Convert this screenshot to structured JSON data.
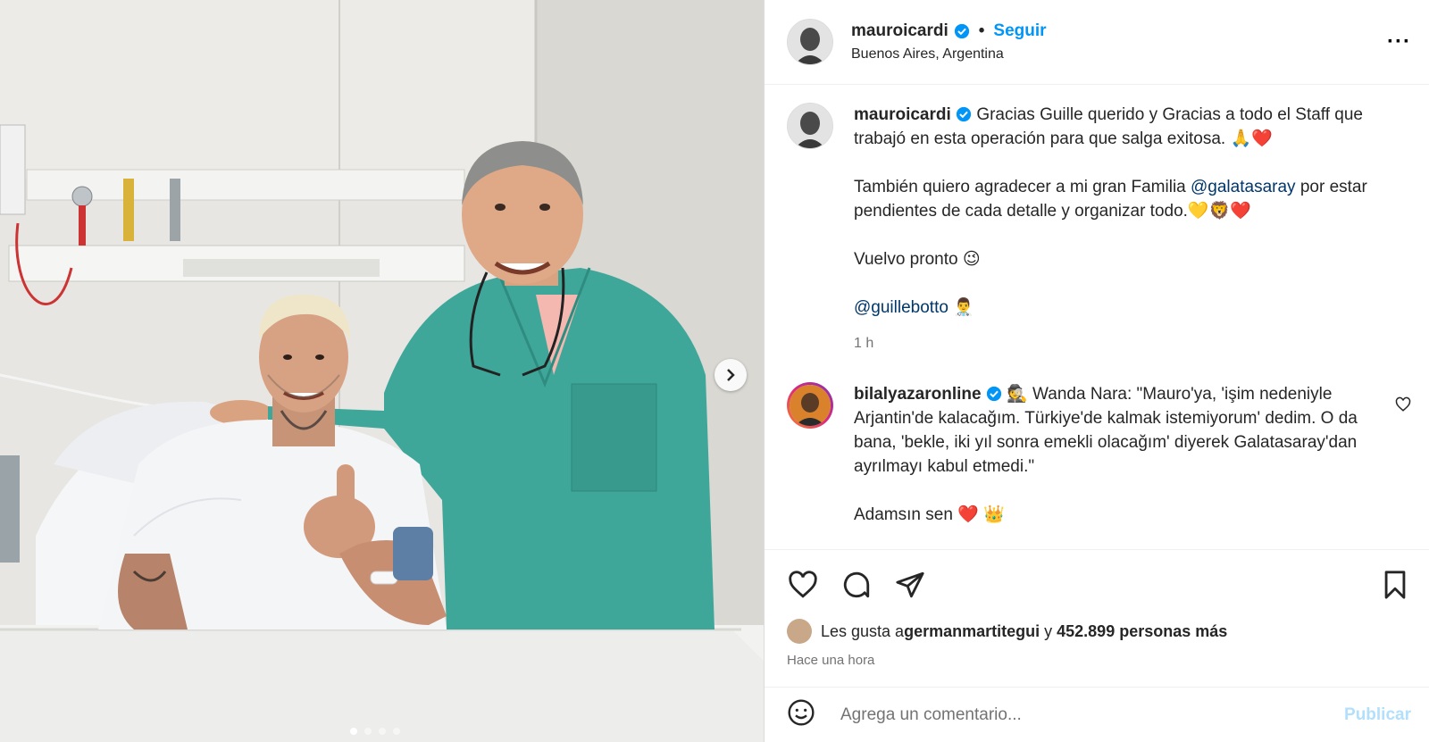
{
  "media": {
    "next_icon": "chevron-right-icon",
    "carousel": {
      "total": 4,
      "active": 1
    }
  },
  "header": {
    "username": "mauroicardi",
    "separator": "•",
    "follow_label": "Seguir",
    "location": "Buenos Aires, Argentina",
    "more_icon": "more-options-icon"
  },
  "caption": {
    "username": "mauroicardi",
    "line1": "Gracias Guille querido y Gracias a todo el Staff que trabajó en esta operación para que salga exitosa. 🙏❤️",
    "line2_pre": "También quiero agradecer a mi gran Familia ",
    "line2_mention": "@galatasaray",
    "line2_post": " por estar pendientes de cada detalle y organizar todo.💛🦁❤️",
    "line3": "Vuelvo pronto 😉",
    "line4_mention": "@guillebotto",
    "line4_emoji": "👨‍⚕️",
    "time": "1 h"
  },
  "comment": {
    "username": "bilalyazaronline",
    "text": "🕵️ Wanda Nara: \"Mauro'ya, 'işim nedeniyle Arjantin'de kalacağım. Türkiye'de kalmak istemiyorum' dedim. O da bana, 'bekle, iki yıl sonra emekli olacağım' diyerek Galatasaray'dan ayrılmayı kabul etmedi.\"",
    "line2": "Adamsın sen ❤️ 👑"
  },
  "likes": {
    "prefix": "Les gusta a ",
    "user": "germanmartitegui",
    "middle": " y ",
    "count": "452.899 personas más"
  },
  "posted": "Hace una hora",
  "add_comment": {
    "placeholder": "Agrega un comentario...",
    "publish_label": "Publicar"
  },
  "colors": {
    "accent": "#0095f6",
    "verified": "#0095f6",
    "scrubs": "#3fa79a",
    "wall": "#e6e5e1"
  }
}
